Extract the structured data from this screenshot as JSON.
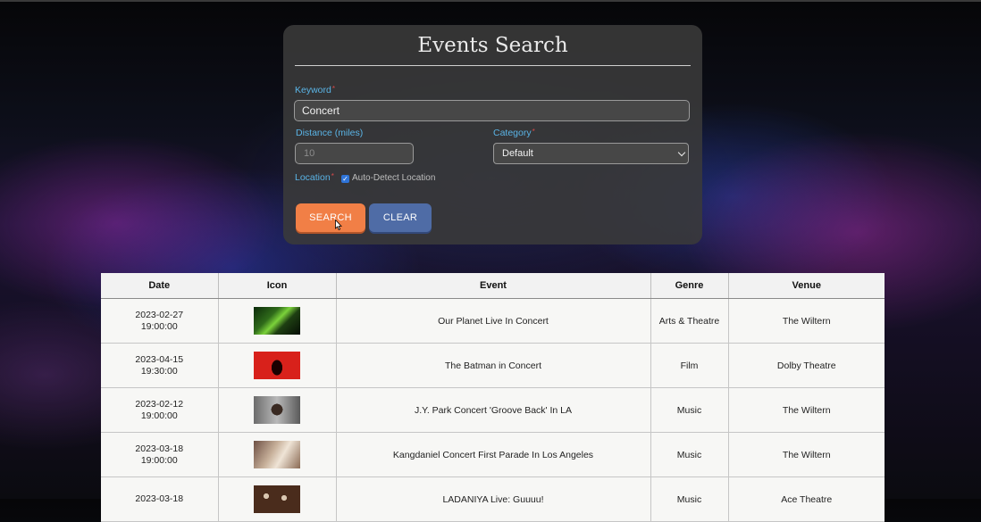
{
  "search": {
    "title": "Events Search",
    "keyword_label": "Keyword",
    "keyword_value": "Concert",
    "distance_label": "Distance (miles)",
    "distance_placeholder": "10",
    "category_label": "Category",
    "category_value": "Default",
    "location_label": "Location",
    "required_mark": "*",
    "auto_detect_label": "Auto-Detect Location",
    "auto_detect_checked": true,
    "search_button": "SEARCH",
    "clear_button": "CLEAR"
  },
  "results": {
    "columns": [
      "Date",
      "Icon",
      "Event",
      "Genre",
      "Venue"
    ],
    "rows": [
      {
        "date": "2023-02-27",
        "time": "19:00:00",
        "event": "Our Planet Live In Concert",
        "genre": "Arts & Theatre",
        "venue": "The Wiltern"
      },
      {
        "date": "2023-04-15",
        "time": "19:30:00",
        "event": "The Batman in Concert",
        "genre": "Film",
        "venue": "Dolby Theatre"
      },
      {
        "date": "2023-02-12",
        "time": "19:00:00",
        "event": "J.Y. Park Concert 'Groove Back' In LA",
        "genre": "Music",
        "venue": "The Wiltern"
      },
      {
        "date": "2023-03-18",
        "time": "19:00:00",
        "event": "Kangdaniel Concert First Parade In Los Angeles",
        "genre": "Music",
        "venue": "The Wiltern"
      },
      {
        "date": "2023-03-18",
        "time": "",
        "event": "LADANIYA Live: Guuuu!",
        "genre": "Music",
        "venue": "Ace Theatre"
      }
    ]
  },
  "colors": {
    "accent_label": "#5ab4e6",
    "search_button": "#f17f46",
    "clear_button": "#4f6ca6",
    "checkbox": "#2f74d8"
  }
}
